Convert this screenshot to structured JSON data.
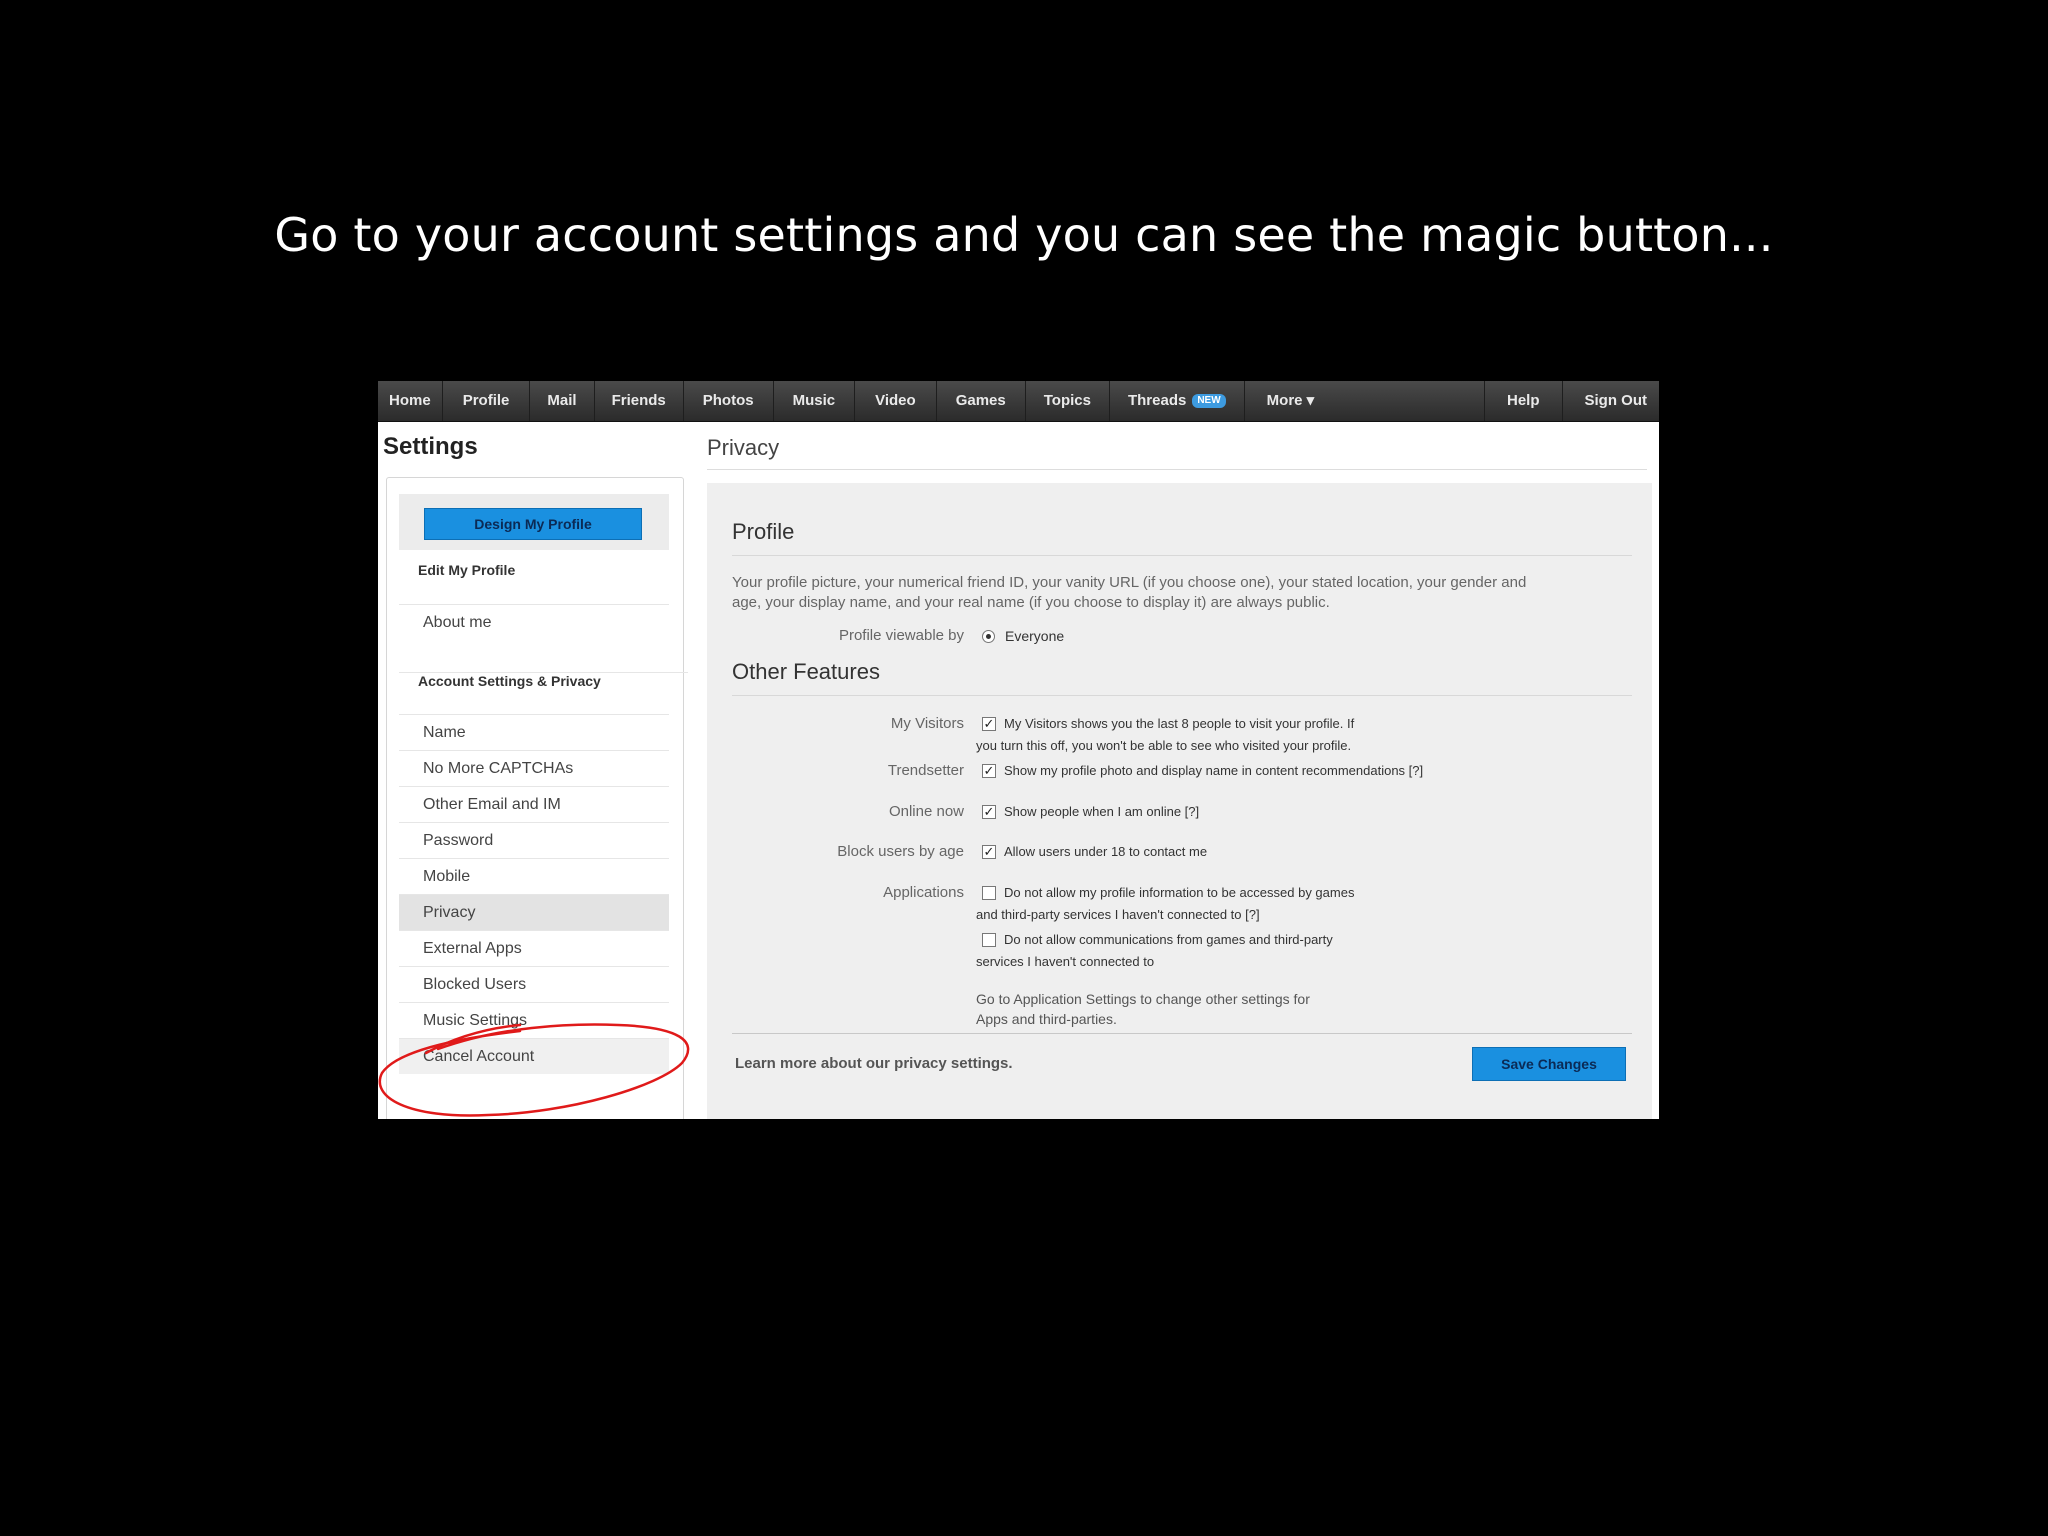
{
  "caption": "Go to your account settings and you can see the magic button...",
  "nav": {
    "items": [
      "Home",
      "Profile",
      "Mail",
      "Friends",
      "Photos",
      "Music",
      "Video",
      "Games",
      "Topics"
    ],
    "threads": "Threads",
    "threads_badge": "NEW",
    "more": "More ▾",
    "help": "Help",
    "sign_out": "Sign Out"
  },
  "sidebar": {
    "title": "Settings",
    "design_button": "Design My Profile",
    "edit_profile_heading": "Edit My Profile",
    "about_me": "About me",
    "account_heading": "Account Settings & Privacy",
    "items": [
      "Name",
      "No More CAPTCHAs",
      "Other Email and IM",
      "Password",
      "Mobile",
      "Privacy",
      "External Apps",
      "Blocked Users",
      "Music Settings",
      "Cancel Account"
    ],
    "active_item": "Privacy"
  },
  "main": {
    "title": "Privacy",
    "profile_heading": "Profile",
    "profile_desc_line1": "Your profile picture, your numerical friend ID, your vanity URL (if you choose one), your stated location, your gender and",
    "profile_desc_line2": "age, your display name, and your real name (if you choose to display it) are always public.",
    "viewable_label": "Profile viewable by",
    "viewable_value": "Everyone",
    "other_heading": "Other Features",
    "my_visitors_label": "My Visitors",
    "my_visitors_line1": "My Visitors shows you the last 8 people to visit your profile. If",
    "my_visitors_line2": "you turn this off, you won't be able to see who visited your profile.",
    "trendsetter_label": "Trendsetter",
    "trendsetter_text": "Show my profile photo and display name in content recommendations [?]",
    "online_label": "Online now",
    "online_text": "Show people when I am online [?]",
    "block_label": "Block users by age",
    "block_text": "Allow users under 18 to contact me",
    "apps_label": "Applications",
    "apps_opt1_line1": "Do not allow my profile information to be accessed by games",
    "apps_opt1_line2": "and third-party services I haven't connected to [?]",
    "apps_opt2_line1": "Do not allow communications from games and third-party",
    "apps_opt2_line2": "services I haven't connected to",
    "apps_note_line1": "Go to Application Settings to change other settings for",
    "apps_note_line2": "Apps and third-parties.",
    "learn_more": "Learn more about our privacy settings.",
    "save_button": "Save Changes"
  },
  "checkboxes": {
    "my_visitors": true,
    "trendsetter": true,
    "online_now": true,
    "block_users": true,
    "apps_opt1": false,
    "apps_opt2": false
  },
  "colors": {
    "button_blue": "#1a90e0",
    "annotation_red": "#e01a1a"
  }
}
